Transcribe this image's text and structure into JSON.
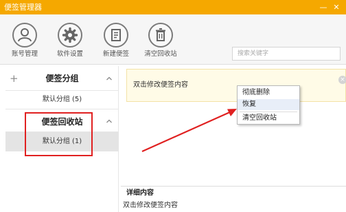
{
  "window": {
    "title": "便签管理器",
    "min_glyph": "—",
    "close_glyph": "✕",
    "accent": "#f5a800"
  },
  "toolbar": {
    "items": [
      {
        "label": "账号管理",
        "icon": "user-icon"
      },
      {
        "label": "软件设置",
        "icon": "gear-icon"
      },
      {
        "label": "新建便签",
        "icon": "note-icon"
      },
      {
        "label": "清空回收站",
        "icon": "trash-icon"
      }
    ],
    "search_placeholder": "搜索关键字"
  },
  "sidebar": {
    "groups_section": {
      "plus": "+",
      "title": "便签分组",
      "items": [
        "默认分组 (5)"
      ]
    },
    "recycle_section": {
      "title": "便签回收站",
      "items": [
        "默认分组 (1)"
      ]
    }
  },
  "note": {
    "text": "双击修改便签内容",
    "close_glyph": "×"
  },
  "context_menu": {
    "items": [
      "彻底删除",
      "恢复",
      "清空回收站"
    ]
  },
  "detail": {
    "title": "详细内容",
    "text": "双击修改便签内容"
  },
  "annotation": {
    "color": "#e02020"
  }
}
